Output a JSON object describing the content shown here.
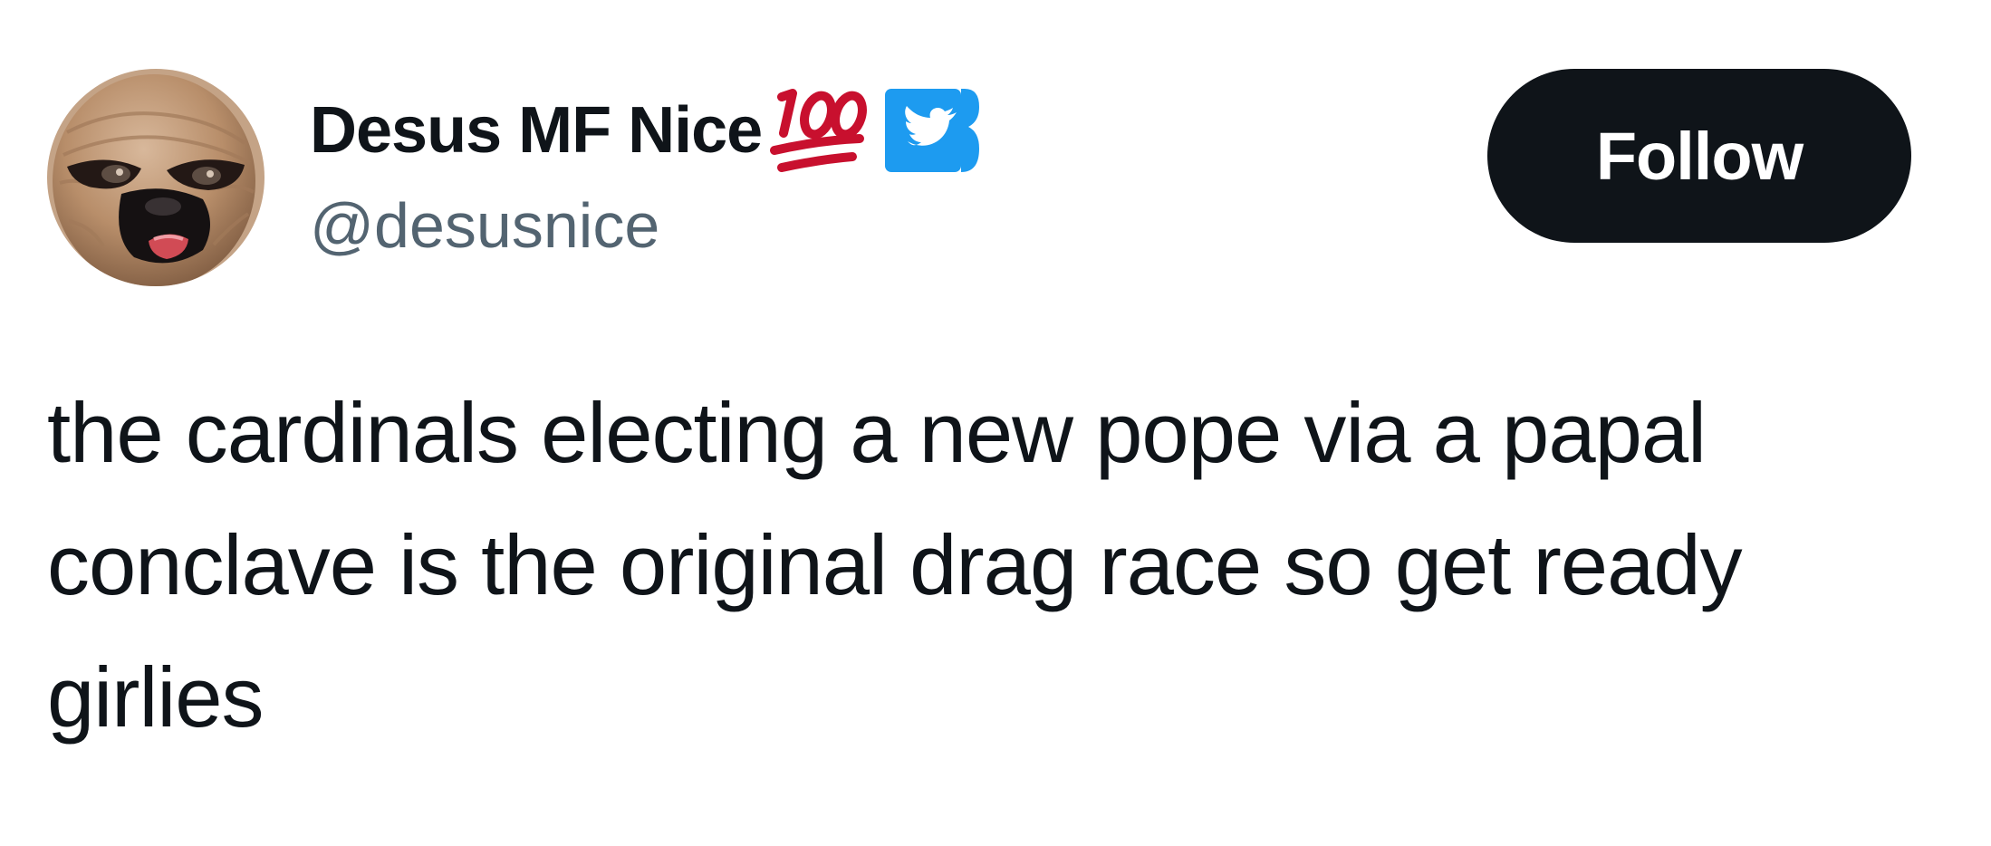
{
  "author": {
    "display_name": "Desus MF Nice",
    "handle": "@desusnice",
    "avatar_icon": "balaclava-avatar-icon",
    "emoji_icon": "hundred-points-emoji-icon",
    "badge_icon": "twitter-bird-verified-icon"
  },
  "actions": {
    "follow_label": "Follow"
  },
  "tweet": {
    "text_lines": [
      "the cardinals electing a new pope via a papal",
      "conclave is the original drag race so get ready",
      "girlies"
    ]
  },
  "colors": {
    "primary_text": "#0f1419",
    "secondary_text": "#536471",
    "follow_button_bg": "#0f1419",
    "follow_button_text": "#ffffff",
    "verified_badge": "#1d9bf0",
    "hundred_emoji": "#c8102e"
  }
}
